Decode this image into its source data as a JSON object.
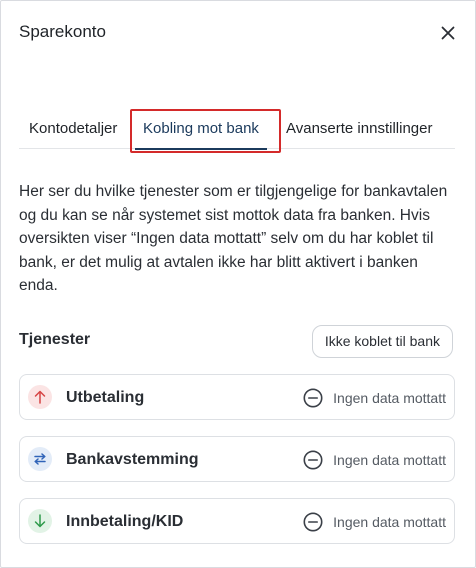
{
  "dialog": {
    "title": "Sparekonto",
    "close_icon": "close-icon"
  },
  "tabs": [
    {
      "label": "Kontodetaljer",
      "active": false
    },
    {
      "label": "Kobling mot bank",
      "active": true
    },
    {
      "label": "Avanserte innstillinger",
      "active": false
    }
  ],
  "description": "Her ser du hvilke tjenester som er tilgjengelige for bankavtalen og du kan se når systemet sist mottok data fra banken. Hvis oversikten viser “Ingen data mottatt” selv om du har koblet til bank, er det mulig at avtalen ikke har blitt aktivert i banken enda.",
  "services": {
    "label": "Tjenester",
    "connection_status": "Ikke koblet til bank",
    "items": [
      {
        "name": "Utbetaling",
        "icon": "arrow-up-icon",
        "icon_color": "#d64545",
        "status": "Ingen data mottatt"
      },
      {
        "name": "Bankavstemming",
        "icon": "swap-arrows-icon",
        "icon_color": "#2f63b8",
        "status": "Ingen data mottatt"
      },
      {
        "name": "Innbetaling/KID",
        "icon": "arrow-down-icon",
        "icon_color": "#2e9a4b",
        "status": "Ingen data mottatt"
      }
    ]
  },
  "colors": {
    "accent": "#1b3a5c",
    "highlight": "#d42a2a"
  }
}
